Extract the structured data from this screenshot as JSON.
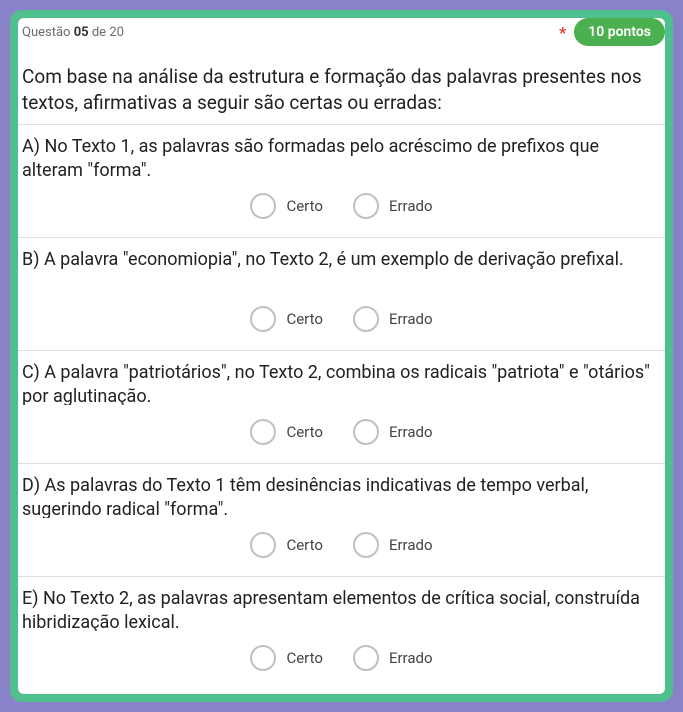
{
  "header": {
    "prefix": "Questão",
    "current": "05",
    "sep": "de",
    "total": "20",
    "asterisk": "*",
    "points": "10 pontos"
  },
  "question": "Com base na análise da estrutura e formação das palavras presentes nos textos, afirmativas a seguir são certas ou erradas:",
  "labels": {
    "correct": "Certo",
    "wrong": "Errado"
  },
  "items": [
    {
      "text": "A) No Texto 1, as palavras são formadas pelo acréscimo de prefixos que alteram \"forma\"."
    },
    {
      "text": "B) A palavra \"economiopia\", no Texto 2, é um exemplo de derivação prefixal."
    },
    {
      "text": "C) A palavra \"patriotários\", no Texto 2, combina os radicais \"patriota\" e \"otários\" por aglutinação."
    },
    {
      "text": "D) As palavras do Texto 1 têm desinências indicativas de tempo verbal, sugerindo radical \"forma\"."
    },
    {
      "text": "E) No Texto 2, as palavras apresentam elementos de crítica social, construída hibridização lexical."
    }
  ]
}
